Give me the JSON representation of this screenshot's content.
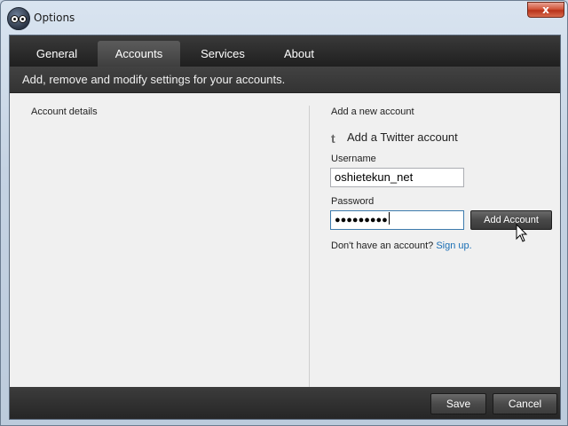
{
  "window": {
    "title": "Options",
    "close_glyph": "x"
  },
  "tabs": [
    {
      "label": "General",
      "active": false
    },
    {
      "label": "Accounts",
      "active": true
    },
    {
      "label": "Services",
      "active": false
    },
    {
      "label": "About",
      "active": false
    }
  ],
  "subheader": "Add, remove and modify settings for your accounts.",
  "left_panel": {
    "heading": "Account details"
  },
  "right_panel": {
    "heading": "Add a new account",
    "service_icon": "twitter-icon",
    "service_label": "Add a Twitter account",
    "username_label": "Username",
    "username_value": "oshietekun_net",
    "password_label": "Password",
    "password_value": "●●●●●●●●●",
    "add_button": "Add Account",
    "no_account_text": "Don't have an account?",
    "signup_link": "Sign up."
  },
  "footer": {
    "save_label": "Save",
    "cancel_label": "Cancel"
  },
  "colors": {
    "link": "#1a6fb5",
    "dark_bar": "#2b2b2b",
    "close_button": "#c8452a"
  }
}
